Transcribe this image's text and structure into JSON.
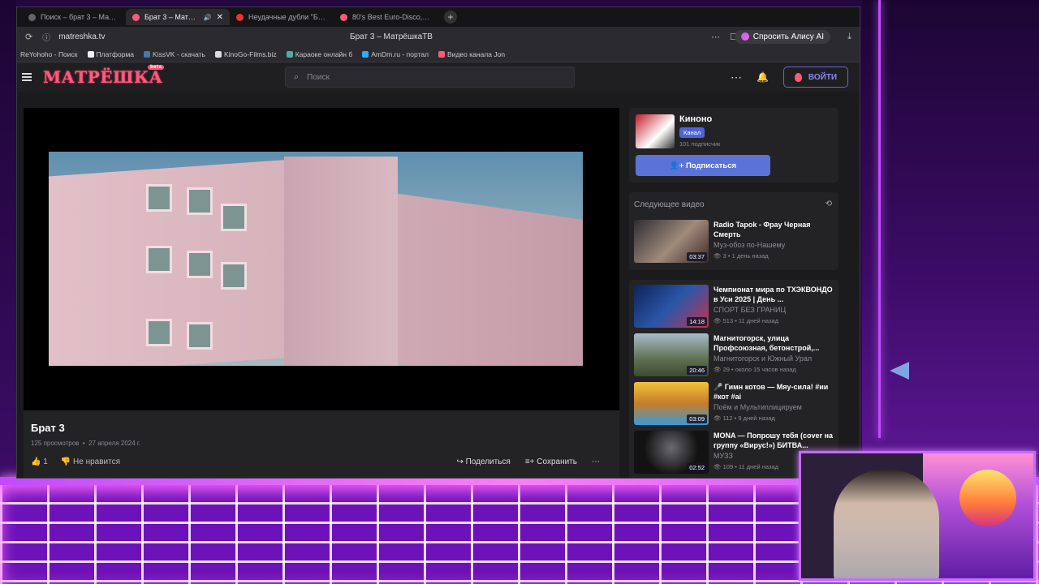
{
  "tabs": [
    {
      "label": "Поиск – брат 3 – Матрё",
      "color": "#888"
    },
    {
      "label": "Брат 3 – МатрёшкаТ",
      "color": "#ff5a7a",
      "active": true
    },
    {
      "label": "Неудачные дубли \"Брат\"",
      "color": "#e33"
    },
    {
      "label": "80's Best Euro-Disco, Synt",
      "color": "#ff5a7a"
    }
  ],
  "address": {
    "url": "matreshka.tv",
    "page_title": "Брат 3 – МатрёшкаТВ",
    "alice_label": "Спросить Алису AI"
  },
  "bookmarks": [
    {
      "label": "ReYohoho - Поиск",
      "color": "#444"
    },
    {
      "label": "Платформа",
      "color": "#eee"
    },
    {
      "label": "KissVK - скачать",
      "color": "#4a76a8"
    },
    {
      "label": "KinoGo-Films.biz",
      "color": "#ddd"
    },
    {
      "label": "Караоке онлайн б",
      "color": "#5aa"
    },
    {
      "label": "AmDm.ru - портал",
      "color": "#3af"
    },
    {
      "label": "Видео канала Jon",
      "color": "#ff5a7a"
    }
  ],
  "site": {
    "logo": "МАТРЁШКА",
    "logo_beta": "beta",
    "search_placeholder": "Поиск",
    "login_label": "ВОЙТИ"
  },
  "video": {
    "title": "Брат 3",
    "views": "125 просмотров",
    "date": "27 апреля 2024 г.",
    "likes": "1",
    "dislike_label": "Не нравится",
    "share_label": "Поделиться",
    "save_label": "Сохранить"
  },
  "channel": {
    "name": "Киноно",
    "badge": "Канал",
    "subscribers": "101 подписчик",
    "subscribe_label": "Подписаться"
  },
  "next": {
    "heading": "Следующее видео",
    "item": {
      "title": "Radio Tapok - Фрау Черная Смерть",
      "channel": "Муз-обоз по-Нашему",
      "meta": "3 • 1 день назад",
      "duration": "03:37"
    }
  },
  "related": [
    {
      "title": "Чемпионат мира по ТХЭКВОНДО в Уси 2025 | День ...",
      "channel": "СПОРТ БЕЗ ГРАНИЦ",
      "meta": "513 • 11 дней назад",
      "duration": "14:18",
      "thumb": "#1a3a78"
    },
    {
      "title": "Магнитогорск, улица Профсоюзная, бетонстрой,...",
      "channel": "Магнитогорск и Южный Урал",
      "meta": "29 • около 15 часов назад",
      "duration": "20:46",
      "thumb": "#5f7052"
    },
    {
      "title": "🎤 Гимн котов — Мяу-сила! #ии #кот #ai",
      "channel": "Поём и Мультиплицируем",
      "meta": "112 • 9 дней назад",
      "duration": "03:09",
      "thumb": "#c77c2a"
    },
    {
      "title": "MONA — Попрошу тебя (cover на группу «Вирус!») БИТВА...",
      "channel": "МУЗЗ",
      "meta": "109 • 11 дней назад",
      "duration": "02:52",
      "thumb": "#121212"
    }
  ]
}
